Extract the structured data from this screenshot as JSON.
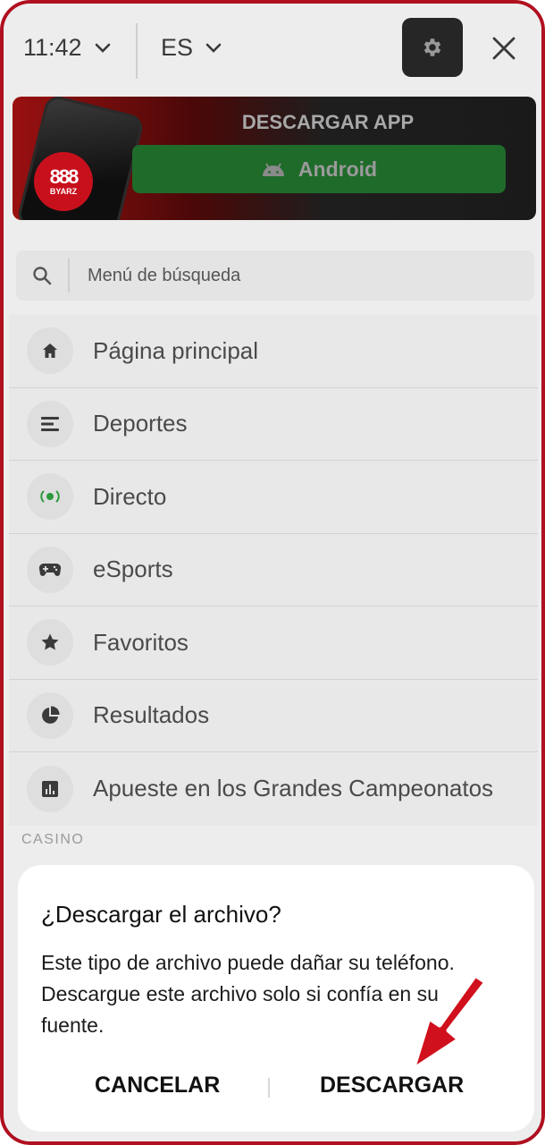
{
  "topbar": {
    "time": "11:42",
    "language": "ES"
  },
  "banner": {
    "title": "DESCARGAR APP",
    "android_label": "Android",
    "logo_text": "BYARZ"
  },
  "search": {
    "placeholder": "Menú de búsqueda"
  },
  "menu": {
    "items": [
      {
        "label": "Página principal",
        "icon": "home-icon"
      },
      {
        "label": "Deportes",
        "icon": "list-icon"
      },
      {
        "label": "Directo",
        "icon": "live-icon"
      },
      {
        "label": "eSports",
        "icon": "gamepad-icon"
      },
      {
        "label": "Favoritos",
        "icon": "star-icon"
      },
      {
        "label": "Resultados",
        "icon": "pie-chart-icon"
      },
      {
        "label": "Apueste en los Grandes Campeonatos",
        "icon": "bar-chart-icon"
      }
    ],
    "section_casino": "CASINO"
  },
  "dialog": {
    "title": "¿Descargar el archivo?",
    "body": "Este tipo de archivo puede dañar su teléfono. Descargue este archivo solo si confía en su fuente.",
    "cancel_label": "CANCELAR",
    "download_label": "DESCARGAR"
  },
  "colors": {
    "accent_red": "#d0101c",
    "android_green": "#1f6b2a",
    "live_green": "#2a9a3a"
  }
}
